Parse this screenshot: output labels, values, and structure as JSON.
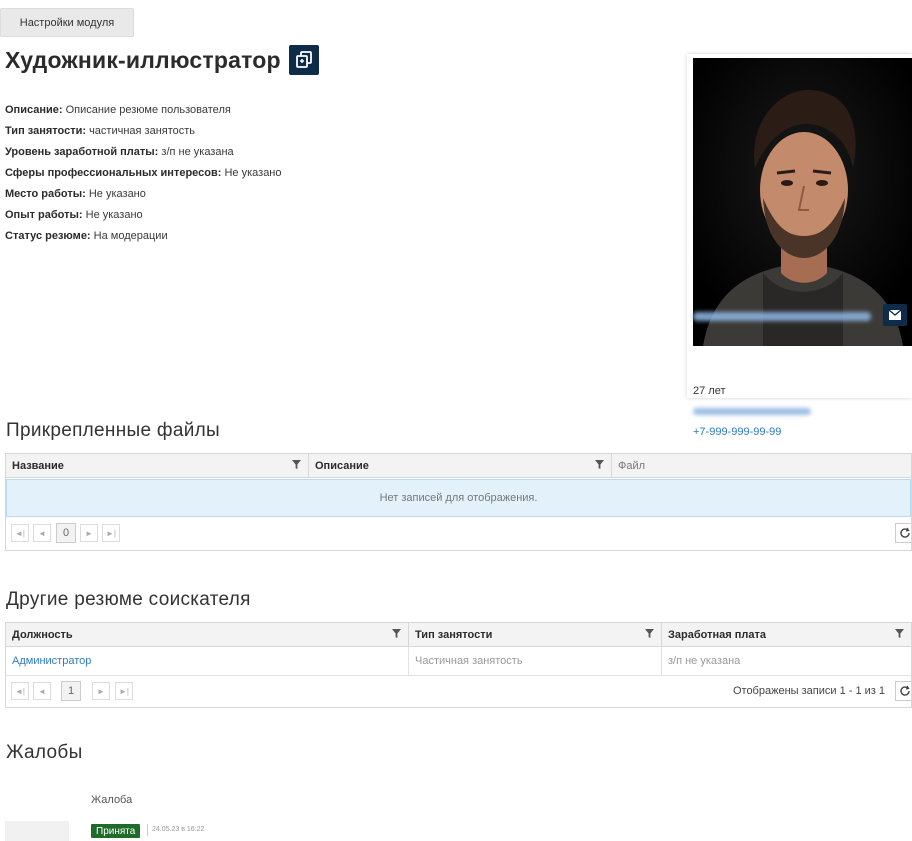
{
  "header": {
    "settings_button": "Настройки модуля",
    "title": "Художник-иллюстратор",
    "copy_icon": "copy-icon"
  },
  "resume_info": [
    {
      "label": "Описание:",
      "value": " Описание резюме пользователя"
    },
    {
      "label": "Тип занятости:",
      "value": " частичная занятость"
    },
    {
      "label": "Уровень заработной платы:",
      "value": " з/п не указана"
    },
    {
      "label": "Сферы профессиональных интересов:",
      "value": " Не указано"
    },
    {
      "label": "Место работы:",
      "value": " Не указано"
    },
    {
      "label": "Опыт работы:",
      "value": " Не указано"
    },
    {
      "label": "Статус резюме:",
      "value": " На модерации"
    }
  ],
  "profile": {
    "age": "27 лет",
    "phone": "+7-999-999-99-99",
    "mail_icon": "envelope-icon"
  },
  "files_section": {
    "title": "Прикрепленные файлы",
    "columns": [
      "Название",
      "Описание",
      "Файл"
    ],
    "empty_text": "Нет записей для отображения.",
    "page": "0"
  },
  "other_resumes": {
    "title": "Другие резюме соискателя",
    "columns": [
      "Должность",
      "Тип занятости",
      "Заработная плата"
    ],
    "rows": [
      {
        "position": "Администратор",
        "employment": "Частичная занятость",
        "salary": "з/п не указана"
      }
    ],
    "page": "1",
    "records_info": "Отображены записи 1 - 1 из 1"
  },
  "complaints": {
    "title": "Жалобы",
    "item_label": "Жалоба",
    "status": "Принята",
    "date": "24.05.23 в 16:22"
  },
  "colors": {
    "accent_dark": "#0f2b4a",
    "link": "#2e7cc0",
    "status_green": "#1f6b2a",
    "empty_row_bg": "#e3f1fa"
  }
}
